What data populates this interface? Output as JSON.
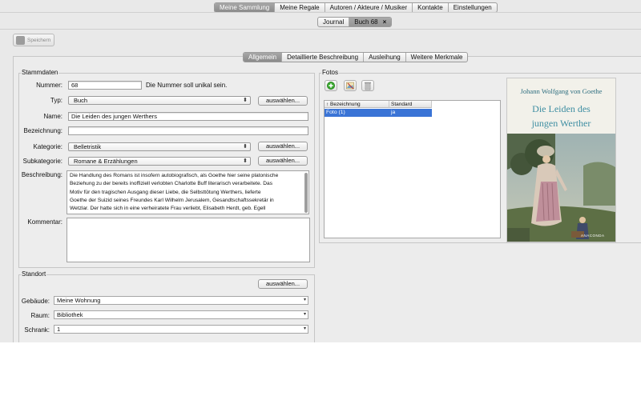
{
  "top_tabs": [
    {
      "label": "Meine Sammlung",
      "selected": true
    },
    {
      "label": "Meine Regale",
      "selected": false
    },
    {
      "label": "Autoren / Akteure / Musiker",
      "selected": false
    },
    {
      "label": "Kontakte",
      "selected": false
    },
    {
      "label": "Einstellungen",
      "selected": false
    }
  ],
  "doc_tabs": [
    {
      "label": "Journal",
      "selected": false
    },
    {
      "label": "Buch 68",
      "selected": true,
      "closable": true,
      "close_glyph": "×"
    }
  ],
  "toolbar": {
    "save_label": "Speichern"
  },
  "sub_tabs": [
    {
      "label": "Allgemein",
      "selected": true
    },
    {
      "label": "Detaillierte Beschreibung",
      "selected": false
    },
    {
      "label": "Ausleihung",
      "selected": false
    },
    {
      "label": "Weitere Merkmale",
      "selected": false
    }
  ],
  "stammdaten": {
    "title": "Stammdaten",
    "nummer_label": "Nummer:",
    "nummer_value": "68",
    "nummer_note": "Die Nummer soll unikal sein.",
    "typ_label": "Typ:",
    "typ_value": "Buch",
    "name_label": "Name:",
    "name_value": "Die Leiden des jungen Werthers",
    "bezeichnung_label": "Bezeichnung:",
    "bezeichnung_value": "",
    "kategorie_label": "Kategorie:",
    "kategorie_value": "Belletristik",
    "subkategorie_label": "Subkategorie:",
    "subkategorie_value": "Romane & Erzählungen",
    "beschreibung_label": "Beschreibung:",
    "beschreibung_lines": [
      "Die Handlung des Romans ist insofern autobiografisch, als Goethe hier seine platonische",
      "Beziehung zu der bereits inoffiziell verlobten Charlotte Buff literarisch verarbeitete. Das",
      "Motiv für den tragischen Ausgang dieser Liebe, die Selbsttötung Werthers, lieferte",
      "Goethe der Suizid seines Freundes Karl Wilhelm Jerusalem, Gesandtschaftssekretär in",
      "Wetzlar. Der hatte sich in eine verheiratete Frau verliebt, Elisabeth Herdt, geb. Egell"
    ],
    "kommentar_label": "Kommentar:",
    "kommentar_value": "",
    "auswaehlen": "auswählen..."
  },
  "standort": {
    "title": "Standort",
    "auswaehlen": "auswählen...",
    "gebaeude_label": "Gebäude:",
    "gebaeude_value": "Meine Wohnung",
    "raum_label": "Raum:",
    "raum_value": "Bibliothek",
    "schrank_label": "Schrank:",
    "schrank_value": "1"
  },
  "fotos": {
    "title": "Fotos",
    "columns": [
      "↑ Bezeichnung",
      "Standard"
    ],
    "rows": [
      {
        "bezeichnung": "Foto (1)",
        "standard": "ja"
      }
    ]
  },
  "cover": {
    "author": "Johann Wolfgang von Goethe",
    "title_line1": "Die Leiden des",
    "title_line2": "jungen Werther",
    "publisher": "ANACONDA"
  },
  "colors": {
    "selection": "#3a74d6",
    "cover_title": "#3e8ea2"
  }
}
